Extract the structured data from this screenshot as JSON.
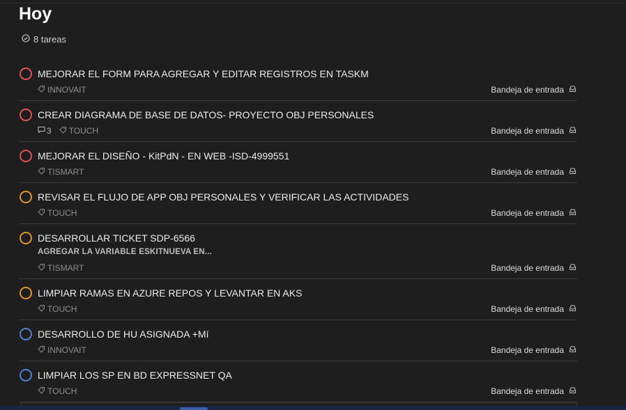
{
  "header": {
    "title": "Hoy",
    "task_count": "8 tareas"
  },
  "project_label": "Bandeja de entrada",
  "tasks": [
    {
      "title": "MEJORAR EL FORM PARA AGREGAR Y EDITAR REGISTROS EN TASKM",
      "label": "INNOVAIT",
      "priority": "p1"
    },
    {
      "title": "CREAR DIAGRAMA DE BASE DE DATOS- PROYECTO OBJ PERSONALES",
      "label": "TOUCH",
      "comments": "3",
      "priority": "p1"
    },
    {
      "title": "MEJORAR EL DISEÑO - KitPdN - EN WEB -ISD-4999551",
      "label": "TISMART",
      "priority": "p1"
    },
    {
      "title": "REVISAR EL FLUJO DE APP OBJ PERSONALES Y VERIFICAR LAS ACTIVIDADES",
      "label": "TOUCH",
      "priority": "p2"
    },
    {
      "title": "DESARROLLAR TICKET SDP-6566",
      "description": "AGREGAR LA VARIABLE ESKITNUEVA EN...",
      "label": "TISMART",
      "priority": "p2"
    },
    {
      "title": "LIMPIAR RAMAS EN AZURE REPOS Y LEVANTAR EN AKS",
      "label": "TOUCH",
      "priority": "p2"
    },
    {
      "title": "DESARROLLO DE HU ASIGNADA +Mí",
      "label": "INNOVAIT",
      "priority": "p3"
    },
    {
      "title": "LIMPIAR LOS SP EN BD EXPRESSNET QA",
      "label": "TOUCH",
      "priority": "p3"
    }
  ],
  "colors": {
    "p1": "#e05252",
    "p2": "#e0962a",
    "p3": "#4f82d6",
    "background": "#1e1e1e"
  },
  "icons": {
    "count": "check-circle-icon",
    "label": "tag-icon",
    "comments": "comment-icon",
    "project": "inbox-icon"
  }
}
